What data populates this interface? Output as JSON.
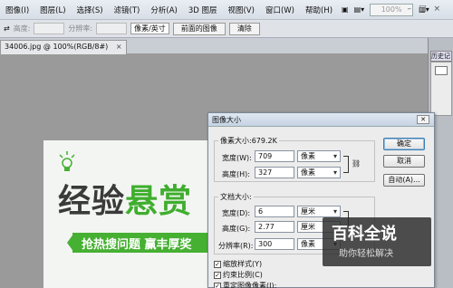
{
  "menubar": {
    "items": [
      "图像(I)",
      "图层(L)",
      "选择(S)",
      "滤镜(T)",
      "分析(A)",
      "3D 图层",
      "视图(V)",
      "窗口(W)",
      "帮助(H)"
    ],
    "zoom": "100%"
  },
  "optionsbar": {
    "height_label": "高度:",
    "resolution_label": "分辨率:",
    "unit_select": "像素/英寸",
    "front_image_button": "前面的图像",
    "clear_button": "清除"
  },
  "document": {
    "tab_title": "34006.jpg @ 100%(RGB/8#)",
    "close": "×"
  },
  "right_panel": {
    "tab_label": "历史记"
  },
  "canvas": {
    "headline_dark": "经验",
    "headline_green": "悬赏",
    "banner_text": "抢热搜问题  赢丰厚奖"
  },
  "dialog": {
    "title": "图像大小",
    "pixel_size_label": "像素大小:679.2K",
    "width_label": "宽度(W):",
    "width_value": "709",
    "width_unit": "像素",
    "height_label": "高度(H):",
    "height_value": "327",
    "height_unit": "像素",
    "doc_size_label": "文档大小:",
    "doc_width_label": "宽度(D):",
    "doc_width_value": "6",
    "doc_width_unit": "厘米",
    "doc_height_label": "高度(G):",
    "doc_height_value": "2.77",
    "doc_height_unit": "厘米",
    "resolution_label": "分辨率(R):",
    "resolution_value": "300",
    "resolution_unit": "像素",
    "ok_button": "确定",
    "cancel_button": "取消",
    "auto_button": "自动(A)...",
    "scale_styles": "缩放样式(Y)",
    "constrain": "约束比例(C)",
    "resample": "重定图像像素(I):"
  },
  "watermark": {
    "logo": "百科全说",
    "subtitle": "助你轻松解决"
  }
}
